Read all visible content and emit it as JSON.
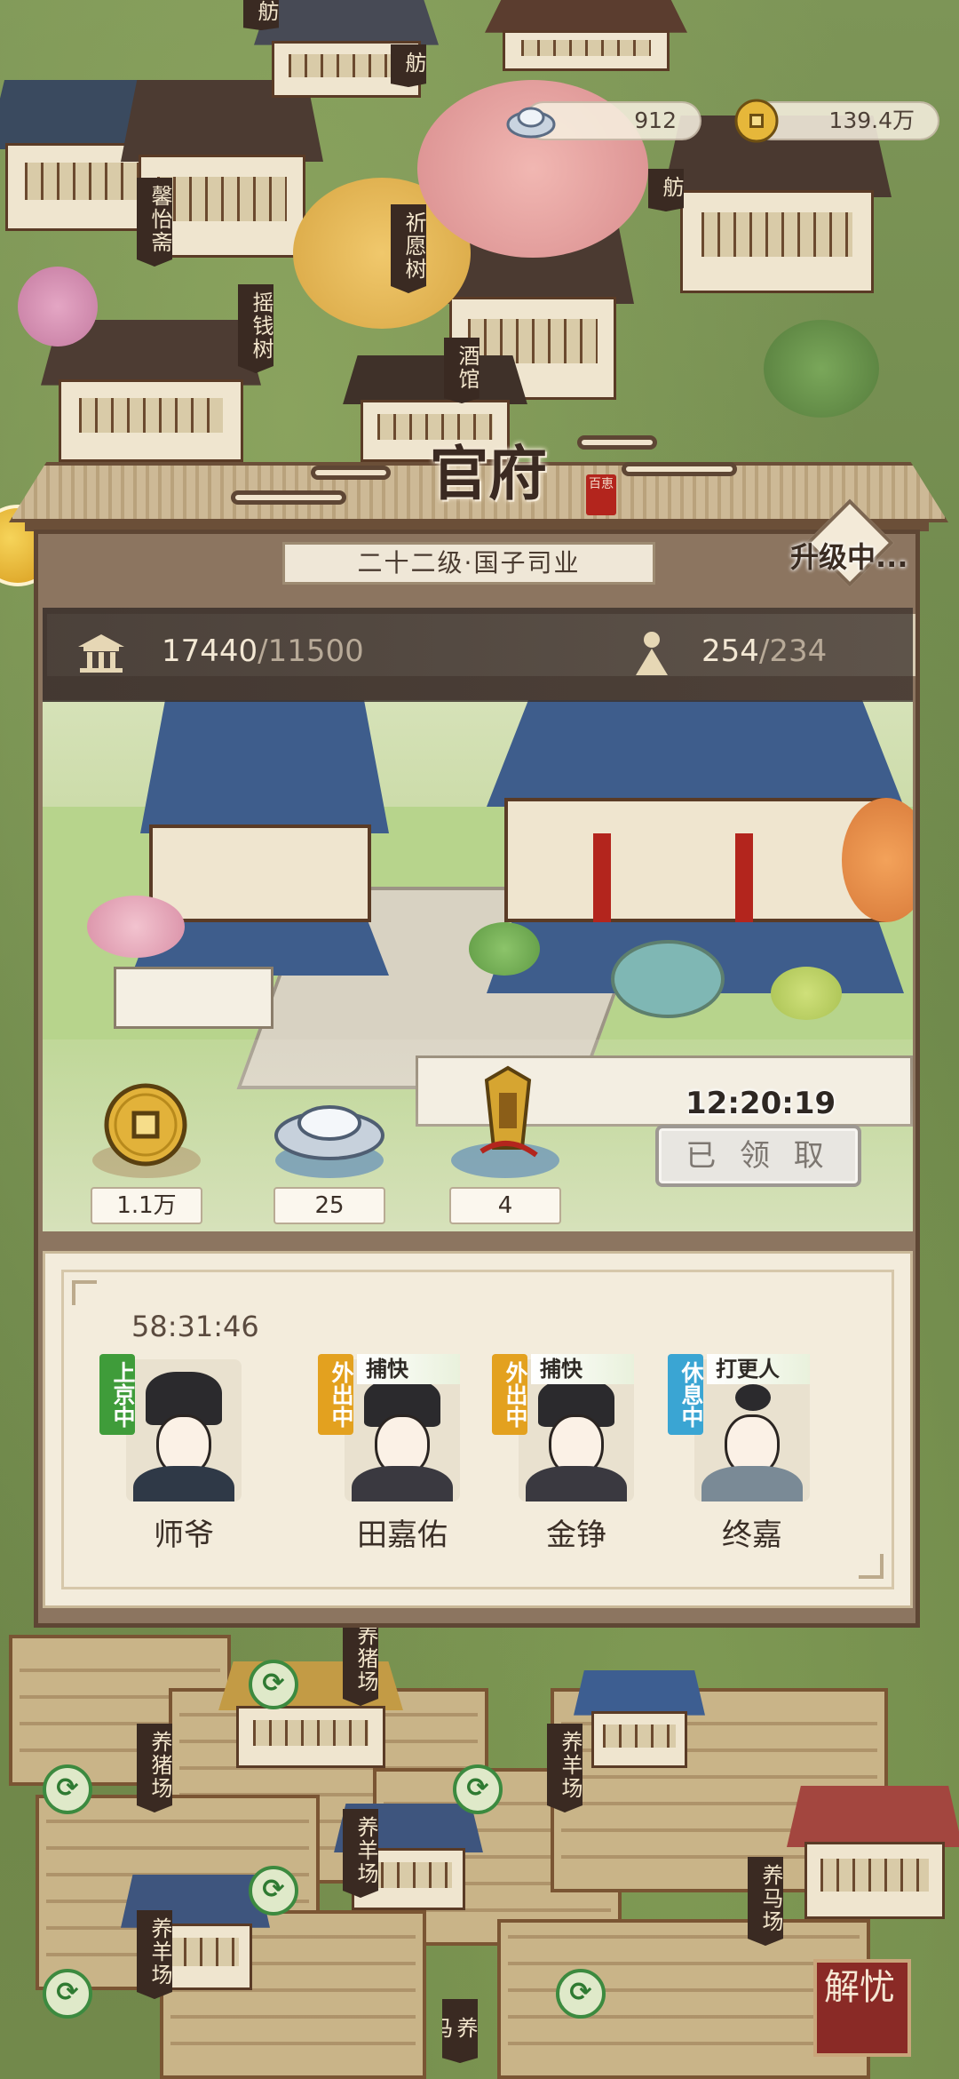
{
  "currency": {
    "silver": "912",
    "coin": "139.4万"
  },
  "map_labels": {
    "top_small": "舫",
    "fang_left": "舫",
    "fang_right": "舫",
    "xinyizhai": "馨怡斋",
    "qiyuanshu": "祈愿树",
    "yaoqianshu": "摇钱树",
    "jiuguan": "酒馆",
    "yangzhuchang_1": "养猪场",
    "yangzhuchang_2": "养猪场",
    "yangyangchang_1": "养羊场",
    "yangyangchang_2": "养羊场",
    "yangyangchang_3": "养羊场",
    "yangmachang": "养马场",
    "yangma_bottom": "养马"
  },
  "panel": {
    "title": "官府",
    "seal": "百恵",
    "level": "二十二级·国子司业",
    "upgrading": "升级中...",
    "population_current": "17440",
    "population_cap": "/11500",
    "staff_current": "254",
    "staff_cap": "/234"
  },
  "rewards": {
    "coins": "1.1万",
    "silver": "25",
    "token": "4",
    "timer": "12:20:19",
    "claim_label": "已 领 取"
  },
  "staff_section": {
    "timer": "58:31:46",
    "members": [
      {
        "name": "师爷",
        "status": "上京中",
        "role": "",
        "status_color": "#3f9c3a"
      },
      {
        "name": "田嘉佑",
        "status": "外出中",
        "role": "捕快",
        "status_color": "#e3a11f"
      },
      {
        "name": "金铮",
        "status": "外出中",
        "role": "捕快",
        "status_color": "#e3a11f"
      },
      {
        "name": "终嘉",
        "status": "休息中",
        "role": "打更人",
        "status_color": "#3aa5d3"
      }
    ]
  },
  "side_button": "解忧",
  "icons": [
    "silver-ingot-icon",
    "copper-coin-icon",
    "pavilion-icon",
    "person-icon",
    "harvest-icon",
    "token-icon"
  ]
}
